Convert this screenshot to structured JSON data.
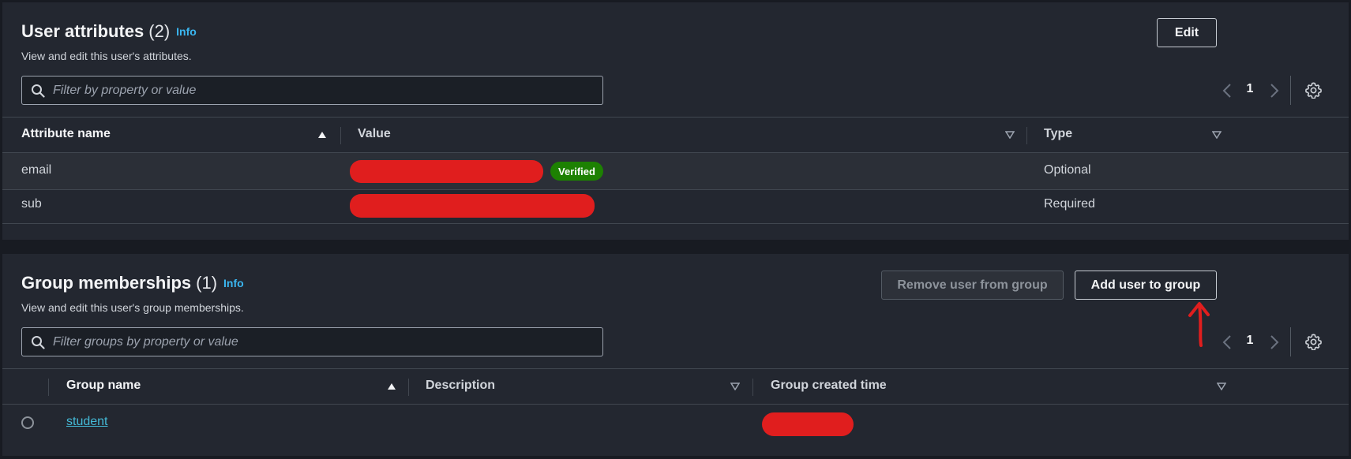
{
  "attributes": {
    "title": "User attributes",
    "count": "(2)",
    "info": "Info",
    "description": "View and edit this user's attributes.",
    "edit_label": "Edit",
    "filter_placeholder": "Filter by property or value",
    "page": "1",
    "columns": [
      "Attribute name",
      "Value",
      "Type"
    ],
    "rows": [
      {
        "name": "email",
        "badge": "Verified",
        "type": "Optional"
      },
      {
        "name": "sub",
        "badge": "",
        "type": "Required"
      }
    ]
  },
  "groups": {
    "title": "Group memberships",
    "count": "(1)",
    "info": "Info",
    "description": "View and edit this user's group memberships.",
    "remove_label": "Remove user from group",
    "add_label": "Add user to group",
    "filter_placeholder": "Filter groups by property or value",
    "page": "1",
    "columns": [
      "Group name",
      "Description",
      "Group created time"
    ],
    "rows": [
      {
        "name": "student"
      }
    ]
  },
  "icons": {
    "search": "search-icon",
    "prev": "chevron-left-icon",
    "next": "chevron-right-icon",
    "settings": "gear-icon",
    "sort_asc": "sort-ascending-icon",
    "sort_desc": "sort-descending-icon"
  },
  "colors": {
    "background": "#181b22",
    "panel": "#232730",
    "link": "#44b9d6",
    "info": "#3ab6f0",
    "verified": "#1d8102",
    "annotation_red": "#e01e1e"
  }
}
